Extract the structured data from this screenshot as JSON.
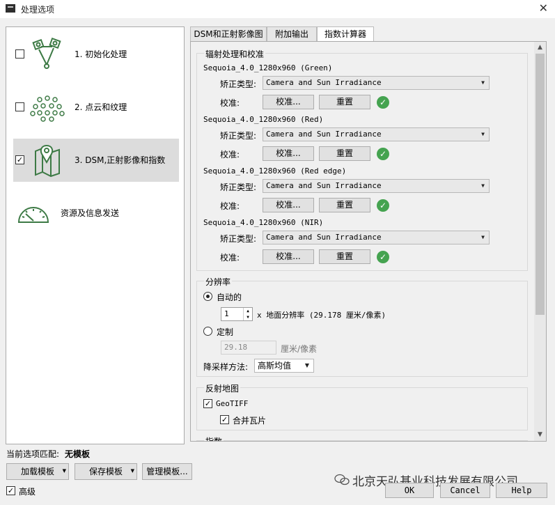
{
  "window": {
    "title": "处理选项",
    "close_glyph": "✕"
  },
  "nav": {
    "items": [
      {
        "label": "1. 初始化处理",
        "checked": false,
        "icon": "camera-network-icon"
      },
      {
        "label": "2. 点云和纹理",
        "checked": false,
        "icon": "point-cloud-icon"
      },
      {
        "label": "3. DSM,正射影像和指数",
        "checked": true,
        "icon": "map-pin-icon"
      },
      {
        "label": "资源及信息发送",
        "icon": "gauge-icon"
      }
    ]
  },
  "tabs": [
    {
      "label": "DSM和正射影像图",
      "active": false
    },
    {
      "label": "附加输出",
      "active": false
    },
    {
      "label": "指数计算器",
      "active": true
    }
  ],
  "radiometry": {
    "title": "辐射处理和校准",
    "correction_label": "矫正类型:",
    "calibration_label": "校准:",
    "calibrate_button": "校准...",
    "reset_button": "重置",
    "bands": [
      {
        "name": "Sequoia_4.0_1280x960 (Green)",
        "correction": "Camera and Sun Irradiance"
      },
      {
        "name": "Sequoia_4.0_1280x960 (Red)",
        "correction": "Camera and Sun Irradiance"
      },
      {
        "name": "Sequoia_4.0_1280x960 (Red edge)",
        "correction": "Camera and Sun Irradiance"
      },
      {
        "name": "Sequoia_4.0_1280x960 (NIR)",
        "correction": "Camera and Sun Irradiance"
      }
    ],
    "status_color": "#45a350"
  },
  "resolution": {
    "title": "分辨率",
    "auto_label": "自动的",
    "auto_selected": true,
    "multiplier": "1",
    "gsd_text": "x 地面分辨率 (29.178 厘米/像素)",
    "custom_label": "定制",
    "custom_value": "29.18",
    "custom_unit": "厘米/像素",
    "downsample_label": "降采样方法:",
    "downsample_value": "高斯均值"
  },
  "reflectance": {
    "title": "反射地图",
    "geotiff_label": "GeoTIFF",
    "geotiff_checked": true,
    "merge_label": "合并瓦片",
    "merge_checked": true
  },
  "index_partial_title": "指数",
  "footer": {
    "template_label": "当前选项匹配:",
    "template_value": "无模板",
    "load_template": "加载模板",
    "save_template": "保存模板",
    "manage_template": "管理模板...",
    "advanced_label": "高级",
    "advanced_checked": true,
    "ok": "OK",
    "cancel": "Cancel",
    "help": "Help"
  },
  "watermark": "北京天弘基业科技发展有限公司"
}
